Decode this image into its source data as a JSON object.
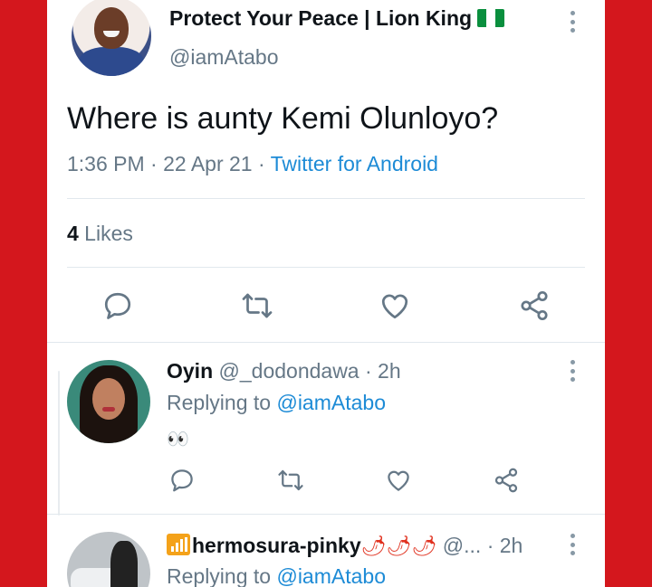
{
  "main_tweet": {
    "display_name": "Protect Your Peace | Lion King",
    "handle": "@iamAtabo",
    "text": "Where is aunty Kemi Olunloyo?",
    "time": "1:36 PM",
    "sep1": " · ",
    "date": "22 Apr 21",
    "sep2": " · ",
    "source": "Twitter for Android",
    "likes_count": "4",
    "likes_label": " Likes"
  },
  "replies": [
    {
      "display_name": "Oyin",
      "handle": "@_dodondawa",
      "age": " · 2h",
      "replying_prefix": "Replying to ",
      "replying_to": "@iamAtabo",
      "text": "👀"
    },
    {
      "display_name": "hermosura-pinky",
      "handle": "@...",
      "age": " · 2h",
      "replying_prefix": "Replying to ",
      "replying_to": "@iamAtabo",
      "peppers": "🌶🌶🌶"
    }
  ],
  "icons": {
    "reply": "reply-icon",
    "retweet": "retweet-icon",
    "like": "heart-icon",
    "share": "share-icon",
    "more": "more-icon"
  },
  "colors": {
    "background": "#d4171d",
    "link": "#1d8bd6",
    "muted": "#657786",
    "text": "#0f1419"
  }
}
